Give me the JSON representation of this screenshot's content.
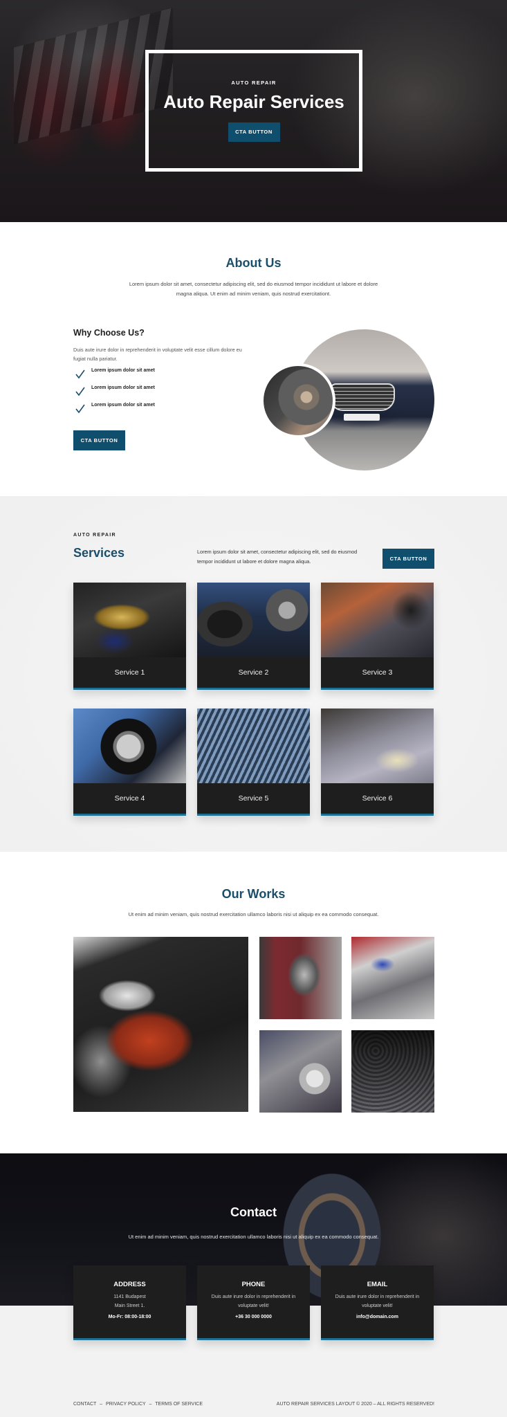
{
  "hero": {
    "eyebrow": "AUTO REPAIR",
    "title": "Auto Repair Services",
    "cta_label": "CTA BUTTON"
  },
  "about": {
    "title": "About Us",
    "description": "Lorem ipsum dolor sit amet, consectetur adipiscing elit, sed do eiusmod tempor incididunt ut labore et dolore magna aliqua. Ut enim ad minim veniam, quis nostrud exercitationt.",
    "why_title": "Why Choose Us?",
    "why_description": "Duis aute irure dolor in reprehenderit in voluptate velit esse cillum dolore eu fugiat nulla pariatur.",
    "checklist": [
      {
        "icon": "check-icon",
        "text": "Lorem ipsum dolor sit amet"
      },
      {
        "icon": "check-icon",
        "text": "Lorem ipsum dolor sit amet"
      },
      {
        "icon": "check-icon",
        "text": "Lorem ipsum dolor sit amet"
      }
    ],
    "cta_label": "CTA BUTTON"
  },
  "services": {
    "eyebrow": "AUTO REPAIR",
    "title": "Services",
    "description": "Lorem ipsum dolor sit amet, consectetur adipiscing elit, sed do eiusmod tempor incididunt ut labore et dolore magna aliqua.",
    "cta_label": "CTA BUTTON",
    "items": [
      {
        "label": "Service 1"
      },
      {
        "label": "Service 2"
      },
      {
        "label": "Service 3"
      },
      {
        "label": "Service 4"
      },
      {
        "label": "Service 5"
      },
      {
        "label": "Service 6"
      }
    ]
  },
  "works": {
    "title": "Our Works",
    "description": "Ut enim ad minim veniam, quis nostrud exercitation ullamco laboris nisi ut aliquip ex ea commodo consequat."
  },
  "contact": {
    "title": "Contact",
    "description": "Ut enim ad minim veniam, quis nostrud exercitation ullamco laboris nisi ut aliquip ex ea commodo consequat.",
    "cards": [
      {
        "heading": "ADDRESS",
        "line1": "1141 Budapest",
        "line2": "Main Street 1.",
        "strong": "Mo-Fr: 08:00-18:00"
      },
      {
        "heading": "PHONE",
        "line1": "Duis aute irure dolor in reprehenderit in",
        "line2": "voluptate velit!",
        "strong": "+36 30 000 0000"
      },
      {
        "heading": "EMAIL",
        "line1": "Duis aute irure dolor in reprehenderit in",
        "line2": "voluptate velit!",
        "strong": "info@domain.com"
      }
    ]
  },
  "footer": {
    "links": [
      "CONTACT",
      "PRIVACY POLICY",
      "TERMS OF SERVICE"
    ],
    "separator": "–",
    "copyright": "AUTO REPAIR SERVICES LAYOUT © 2020 – ALL RIGHTS RESERVED!"
  },
  "colors": {
    "accent": "#104e6d",
    "heading": "#1a4e6a",
    "card_dark": "#1e1e1e",
    "card_border": "#1d6f93"
  }
}
